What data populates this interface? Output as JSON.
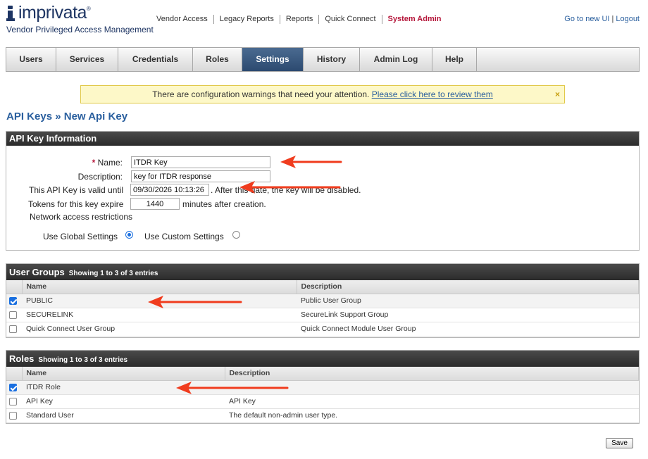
{
  "brand": {
    "logo_text": "imprivata",
    "tagline": "Vendor Privileged Access Management"
  },
  "topnav": {
    "items": [
      "Vendor Access",
      "Legacy Reports",
      "Reports",
      "Quick Connect",
      "System Admin"
    ],
    "active": "System Admin"
  },
  "toplinks": {
    "new_ui": "Go to new UI",
    "separator": "|",
    "logout": "Logout"
  },
  "tabs": {
    "items": [
      "Users",
      "Services",
      "Credentials",
      "Roles",
      "Settings",
      "History",
      "Admin Log",
      "Help"
    ],
    "active": "Settings"
  },
  "warning": {
    "message": "There are configuration warnings that need your attention.",
    "link": "Please click here to review them",
    "close": "×"
  },
  "breadcrumb": {
    "parent": "API Keys",
    "separator": "»",
    "current": "New Api Key"
  },
  "api_key_info": {
    "title": "API Key Information",
    "name_required_mark": "*",
    "name_label": "Name:",
    "name_value": "ITDR Key",
    "description_label": "Description:",
    "description_value": "key for ITDR response",
    "valid_until_label": "This API Key is valid until",
    "valid_until_value": "09/30/2026 10:13:26",
    "valid_until_suffix": ". After this date, the key will be disabled.",
    "expire_label": "Tokens for this key expire",
    "expire_value": "1440",
    "expire_suffix": "minutes after creation.",
    "network_label": "Network access restrictions",
    "global_label": "Use Global Settings",
    "custom_label": "Use Custom Settings",
    "selected": "global"
  },
  "user_groups": {
    "title": "User Groups",
    "subtitle": "Showing 1 to 3 of 3 entries",
    "col_name": "Name",
    "col_description": "Description",
    "rows": [
      {
        "name": "PUBLIC",
        "description": "Public User Group",
        "checked": true
      },
      {
        "name": "SECURELINK",
        "description": "SecureLink Support Group",
        "checked": false
      },
      {
        "name": "Quick Connect User Group",
        "description": "Quick Connect Module User Group",
        "checked": false
      }
    ]
  },
  "roles": {
    "title": "Roles",
    "subtitle": "Showing 1 to 3 of 3 entries",
    "col_name": "Name",
    "col_description": "Description",
    "rows": [
      {
        "name": "ITDR Role",
        "description": "",
        "checked": true
      },
      {
        "name": "API Key",
        "description": "API Key",
        "checked": false
      },
      {
        "name": "Standard User",
        "description": "The default non-admin user type.",
        "checked": false
      }
    ]
  },
  "save_label": "Save",
  "colors": {
    "brand_navy": "#1e3563",
    "link_blue": "#2a5f9e",
    "admin_red": "#b5163a",
    "arrow_red": "#f03c1e"
  }
}
